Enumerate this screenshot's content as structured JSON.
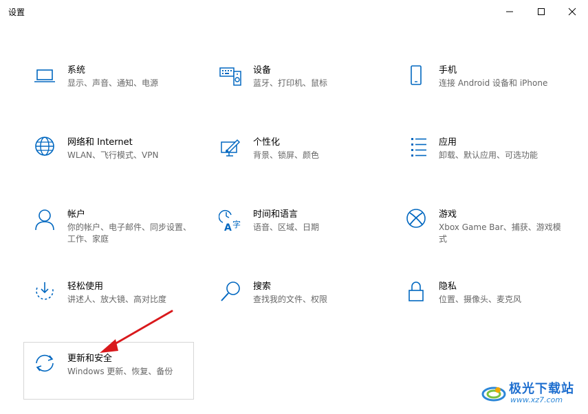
{
  "window": {
    "title": "设置"
  },
  "tiles": [
    {
      "name": "系统",
      "desc": "显示、声音、通知、电源",
      "icon": "laptop-icon"
    },
    {
      "name": "设备",
      "desc": "蓝牙、打印机、鼠标",
      "icon": "keyboard-speaker-icon"
    },
    {
      "name": "手机",
      "desc": "连接 Android 设备和 iPhone",
      "icon": "phone-icon"
    },
    {
      "name": "网络和 Internet",
      "desc": "WLAN、飞行模式、VPN",
      "icon": "globe-icon"
    },
    {
      "name": "个性化",
      "desc": "背景、锁屏、颜色",
      "icon": "paint-icon"
    },
    {
      "name": "应用",
      "desc": "卸载、默认应用、可选功能",
      "icon": "app-list-icon"
    },
    {
      "name": "帐户",
      "desc": "你的帐户、电子邮件、同步设置、工作、家庭",
      "icon": "person-icon"
    },
    {
      "name": "时间和语言",
      "desc": "语音、区域、日期",
      "icon": "time-language-icon"
    },
    {
      "name": "游戏",
      "desc": "Xbox Game Bar、捕获、游戏模式",
      "icon": "xbox-icon"
    },
    {
      "name": "轻松使用",
      "desc": "讲述人、放大镜、高对比度",
      "icon": "ease-of-access-icon"
    },
    {
      "name": "搜索",
      "desc": "查找我的文件、权限",
      "icon": "search-icon"
    },
    {
      "name": "隐私",
      "desc": "位置、摄像头、麦克风",
      "icon": "lock-icon"
    },
    {
      "name": "更新和安全",
      "desc": "Windows 更新、恢复、备份",
      "icon": "sync-icon"
    }
  ],
  "watermark": {
    "brand": "极光下载站",
    "url": "www.xz7.com"
  },
  "colors": {
    "accent": "#0067c0",
    "arrow": "#d9191c",
    "desc_text": "#666666"
  }
}
